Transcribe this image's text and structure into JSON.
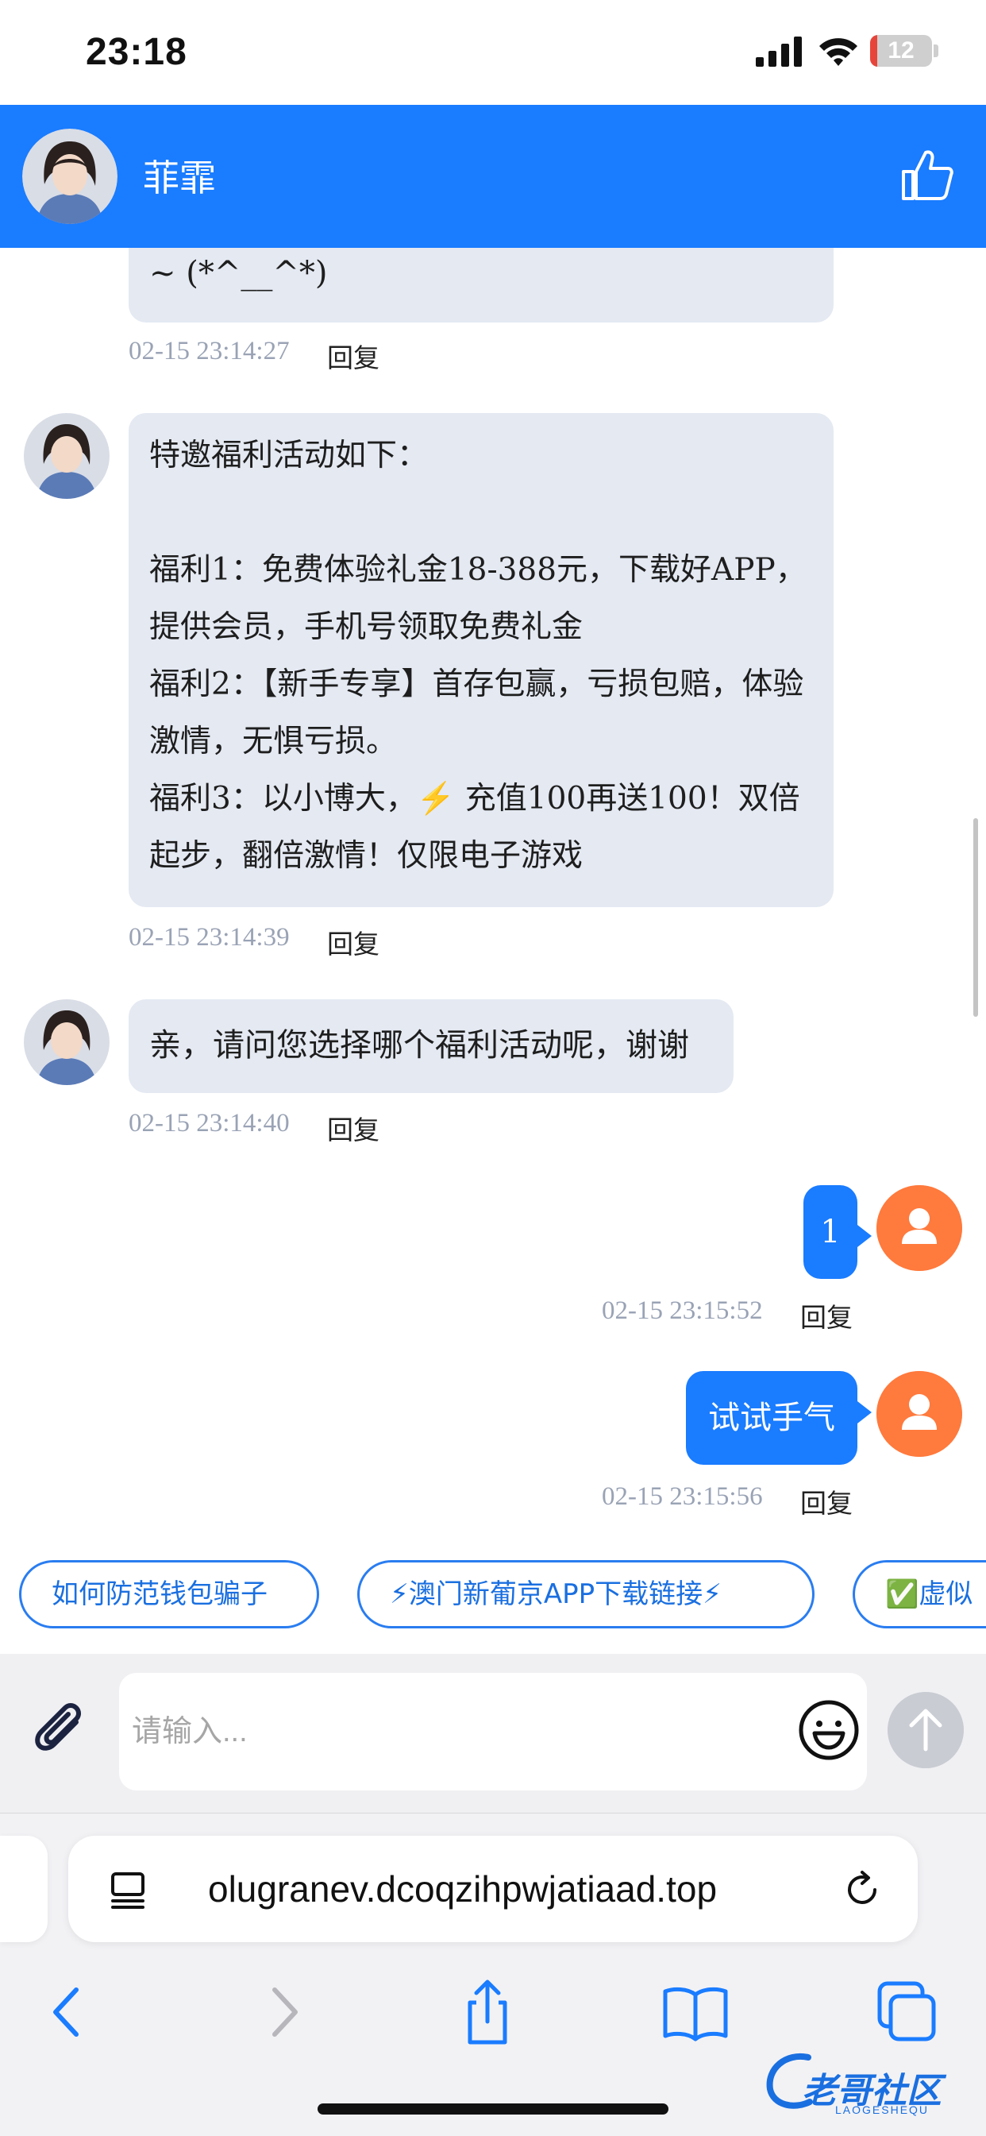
{
  "status_bar": {
    "time": "23:18",
    "battery": "12",
    "battery_level": 0.12
  },
  "header": {
    "name": "菲霏"
  },
  "messages": [
    {
      "text": "~ (*^__^*)",
      "time": "02-15 23:14:27",
      "reply": "回复"
    },
    {
      "text": "特邀福利活动如下：\n\n福利1：免费体验礼金18-388元，下载好APP，提供会员，手机号领取免费礼金\n福利2：【新手专享】首存包赢，亏损包赔，体验激情，无惧亏损。\n福利3：以小博大，⚡ 充值100再送100！双倍起步，翻倍激情！仅限电子游戏",
      "time": "02-15 23:14:39",
      "reply": "回复"
    },
    {
      "text": "亲，请问您选择哪个福利活动呢，谢谢",
      "time": "02-15 23:14:40",
      "reply": "回复"
    },
    {
      "text": "1",
      "time": "02-15 23:15:52",
      "reply": "回复"
    },
    {
      "text": "试试手气",
      "time": "02-15 23:15:56",
      "reply": "回复"
    }
  ],
  "quick_replies": [
    "如何防范钱包骗子",
    "⚡澳门新葡京APP下载链接⚡",
    "✅虚似"
  ],
  "input": {
    "placeholder": "请输入..."
  },
  "browser": {
    "url": "olugranev.dcoqzihpwjatiaad.top"
  },
  "watermark": {
    "text": "老哥社区",
    "sub": "LAOGESHEQU"
  }
}
